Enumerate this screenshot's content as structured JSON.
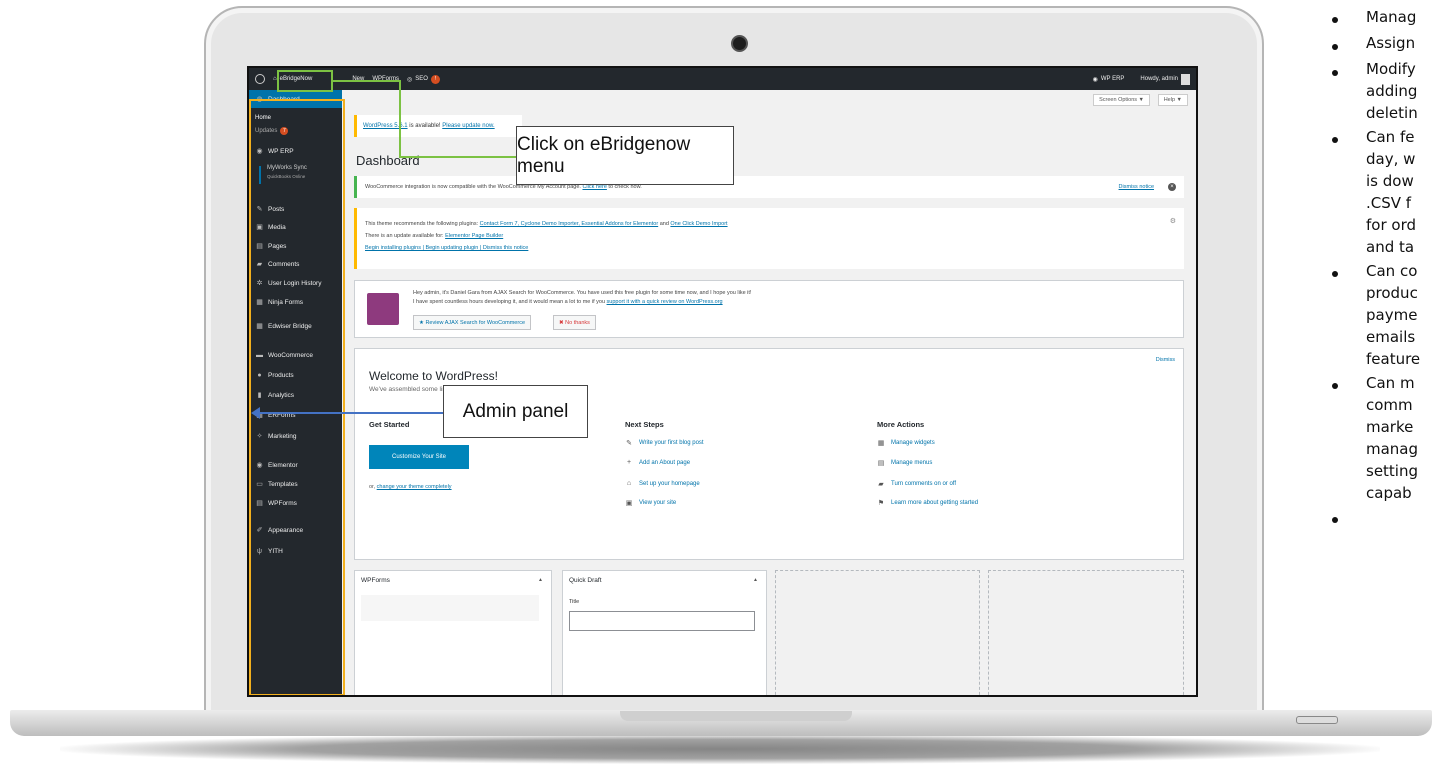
{
  "admin_bar": {
    "site_name": "eBridgeNow",
    "new_label": "New",
    "wpforms_label": "WPForms",
    "seo_label": "SEO",
    "seo_badge": "!",
    "wp_erp_label": "WP ERP",
    "howdy": "Howdy, admin"
  },
  "sidebar": {
    "dashboard": "Dashboard",
    "home": "Home",
    "updates": "Updates",
    "updates_badge": "7",
    "items": [
      "WP ERP",
      "MyWorks Sync",
      "QuickBooks Online",
      "Posts",
      "Media",
      "Pages",
      "Comments",
      "User Login History",
      "Ninja Forms",
      "Edwiser Bridge",
      "WooCommerce",
      "Products",
      "Analytics",
      "ERForms",
      "Marketing",
      "Elementor",
      "Templates",
      "WPForms",
      "Appearance",
      "YITH"
    ]
  },
  "content": {
    "screen_options": "Screen Options ▼",
    "help": "Help ▼",
    "update_nag_link": "WordPress 5.6.1",
    "update_nag_text": " is available! ",
    "update_nag_cta": "Please update now.",
    "title": "Dashboard",
    "woo_notice": "WooCommerce integration is now compatible with the WooCommerce My Account page. ",
    "woo_notice_link": "Click here",
    "woo_notice_tail": " to check now.",
    "dismiss_notice": "Dismiss notice",
    "theme_line1_a": "This theme recommends the following plugins: ",
    "theme_line1_links": "Contact Form 7, Cyclone Demo Importer, Essential Addons for Elementor",
    "theme_line1_and": " and ",
    "theme_line1_last": "One Click Demo Import",
    "theme_line2_a": "There is an update available for: ",
    "theme_line2_link": "Elementor Page Builder",
    "theme_line3": "Begin installing plugins | Begin updating plugin | Dismiss this notice",
    "ajax_line1": "Hey admin, it's Daniel Gara from AJAX Search for WooCommerce. You have used this free plugin for some time now, and I hope you like it!",
    "ajax_line2": "I have spent countless hours developing it, and it would mean a lot to me if you ",
    "ajax_line2_link": "support it with a quick review on WordPress.org",
    "review_btn": "★ Review AJAX Search for WooCommerce",
    "no_thanks_btn": "✖ No thanks",
    "welcome_title": "Welcome to WordPress!",
    "welcome_sub": "We've assembled some links to get you started:",
    "welcome_dismiss": "Dismiss",
    "get_started": "Get Started",
    "customize_btn": "Customize Your Site",
    "or_text": "or, ",
    "change_theme_link": "change your theme completely",
    "next_steps": "Next Steps",
    "next_items": [
      "Write your first blog post",
      "Add an About page",
      "Set up your homepage",
      "View your site"
    ],
    "more_actions": "More Actions",
    "more_items": [
      "Manage widgets",
      "Manage menus",
      "Turn comments on or off",
      "Learn more about getting started"
    ],
    "wpforms_panel": "WPForms",
    "quick_draft": "Quick Draft",
    "title_field": "Title"
  },
  "callouts": {
    "click_menu": "Click on eBridgenow menu",
    "admin_panel": "Admin panel"
  },
  "bullets": [
    [
      "Manag"
    ],
    [
      "Assign"
    ],
    [
      "Modify",
      "adding",
      "deletin"
    ],
    [
      "Can fe",
      "day, w",
      "is dow",
      ".CSV f",
      "for ord",
      "and ta"
    ],
    [
      "Can co",
      "produc",
      "payme",
      "emails",
      "feature"
    ],
    [
      "Can m",
      "comm",
      "marke",
      "manag",
      "setting",
      "capab"
    ],
    [
      ""
    ]
  ],
  "colors": {
    "admin_bar": "#23282d",
    "accent": "#0073aa",
    "highlight_green": "#7cc243",
    "highlight_orange": "#f2b01e",
    "arrow_blue": "#4472c4"
  }
}
